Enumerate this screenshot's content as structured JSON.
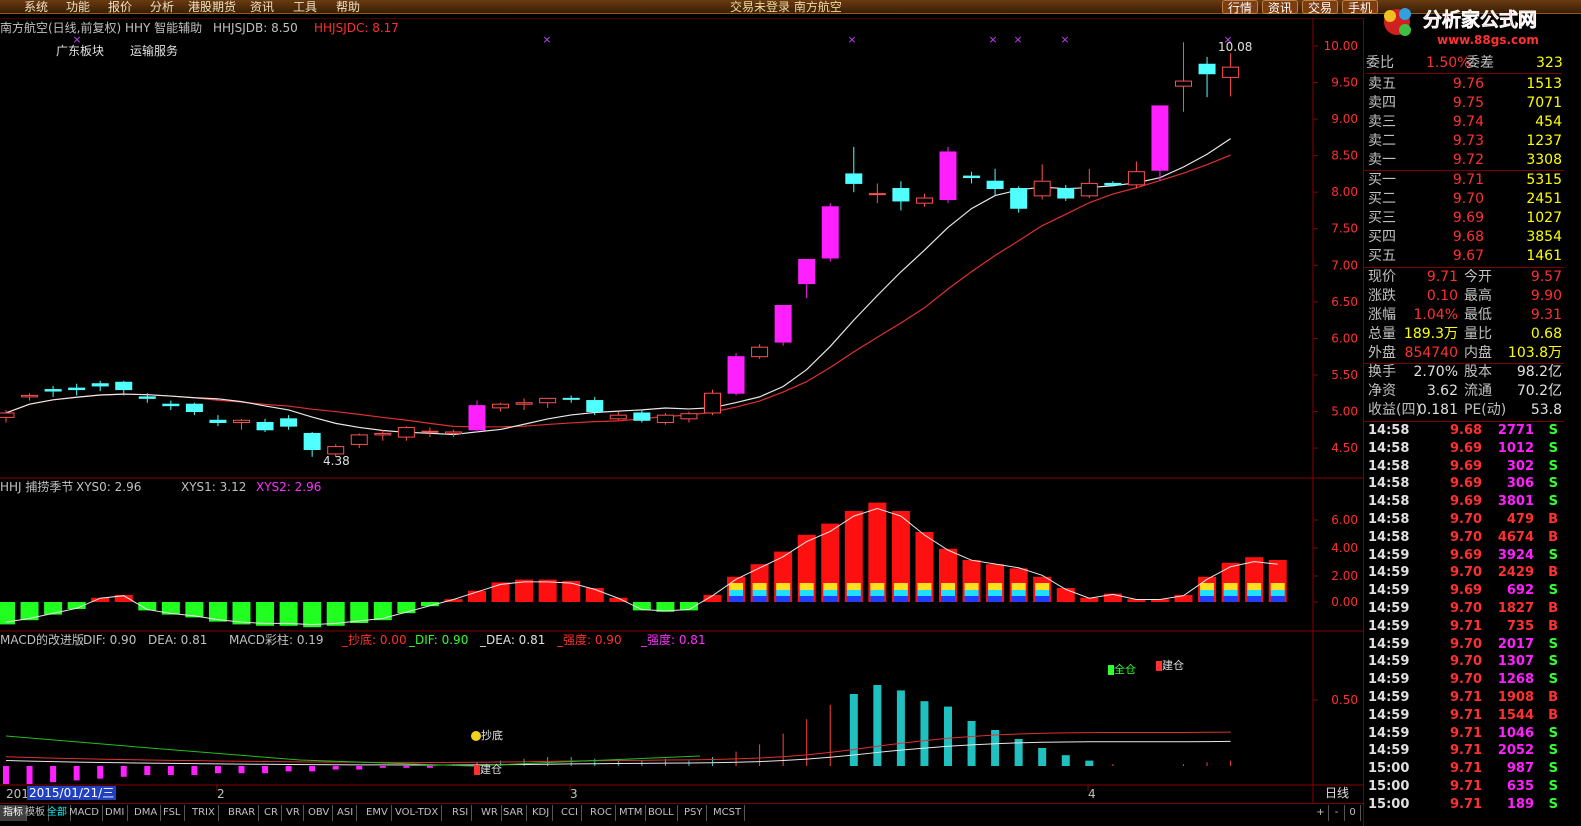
{
  "menu": [
    "系统",
    "功能",
    "报价",
    "分析",
    "港股期货",
    "资讯",
    "工具",
    "帮助"
  ],
  "window_title": "交易未登录   南方航空",
  "top_buttons": [
    "行情",
    "资讯",
    "交易",
    "手机"
  ],
  "logo": {
    "text": "分析家公式网",
    "url": "www.88gs.com"
  },
  "main_chart": {
    "title": "南方航空(日线,前复权) HHY 智能辅助",
    "hhjsjdb": "HHJSJDB: 8.50",
    "hhjsjdc": "HHJSJDC: 8.17",
    "tags": [
      "广东板块",
      "运输服务"
    ],
    "high_label": "10.08",
    "low_label": "4.38",
    "y_ticks": [
      "10.00",
      "9.50",
      "9.00",
      "8.50",
      "8.00",
      "7.50",
      "7.00",
      "6.50",
      "6.00",
      "5.50",
      "5.00",
      "4.50"
    ]
  },
  "xys_panel": {
    "title": "HHJ 捕捞季节",
    "xys0": "XYS0: 2.96",
    "xys1": "XYS1: 3.12",
    "xys2": "XYS2: 2.96",
    "y_ticks": [
      "6.00",
      "4.00",
      "2.00",
      "0.00"
    ]
  },
  "macd_panel": {
    "title": "MACD的改进版",
    "dif": "DIF: 0.90",
    "dea": "DEA: 0.81",
    "macd": "MACD彩柱: 0.19",
    "chaodi": "_抄底: 0.00",
    "dif2": "_DIF: 0.90",
    "dea2": "_DEA: 0.81",
    "qiangdu": "_强度: 0.90",
    "qiangdu2": "_强度: 0.81",
    "y_ticks": [
      "0.50"
    ],
    "marks": {
      "chaodi": "抄底",
      "jiancang": "建仓",
      "quancang": "全仓",
      "jiancang2": "建仓"
    }
  },
  "x_axis": {
    "start": "201",
    "date": "2015/01/21/三",
    "marks": [
      "2",
      "3",
      "4"
    ],
    "period": "日线"
  },
  "tabs": [
    "指标",
    "模板",
    "全部",
    "MACD",
    "DMI",
    "DMA",
    "FSL",
    "TRIX",
    "BRAR",
    "CR",
    "VR",
    "OBV",
    "ASI",
    "EMV",
    "VOL-TDX",
    "RSI",
    "WR",
    "SAR",
    "KDJ",
    "CCI",
    "ROC",
    "MTM",
    "BOLL",
    "PSY",
    "MCST"
  ],
  "scroll_btns": [
    "+",
    "-",
    "0"
  ],
  "side": {
    "header_partial": [
      "委比",
      "1.50%",
      "委差",
      "323"
    ],
    "sells": [
      {
        "name": "卖五",
        "price": "9.76",
        "vol": "1513"
      },
      {
        "name": "卖四",
        "price": "9.75",
        "vol": "7071"
      },
      {
        "name": "卖三",
        "price": "9.74",
        "vol": "454"
      },
      {
        "name": "卖二",
        "price": "9.73",
        "vol": "1237"
      },
      {
        "name": "卖一",
        "price": "9.72",
        "vol": "3308"
      }
    ],
    "buys": [
      {
        "name": "买一",
        "price": "9.71",
        "vol": "5315"
      },
      {
        "name": "买二",
        "price": "9.70",
        "vol": "2451"
      },
      {
        "name": "买三",
        "price": "9.69",
        "vol": "1027"
      },
      {
        "name": "买四",
        "price": "9.68",
        "vol": "3854"
      },
      {
        "name": "买五",
        "price": "9.67",
        "vol": "1461"
      }
    ],
    "quote": [
      [
        "现价",
        "9.71",
        "今开",
        "9.57"
      ],
      [
        "涨跌",
        "0.10",
        "最高",
        "9.90"
      ],
      [
        "涨幅",
        "1.04%",
        "最低",
        "9.31"
      ],
      [
        "总量",
        "189.3万",
        "量比",
        "0.68"
      ],
      [
        "外盘",
        "854740",
        "内盘",
        "103.8万"
      ],
      [
        "换手",
        "2.70%",
        "股本",
        "98.2亿"
      ],
      [
        "净资",
        "3.62",
        "流通",
        "70.2亿"
      ],
      [
        "收益(四)",
        "0.181",
        "PE(动)",
        "53.8"
      ]
    ],
    "ticks": [
      [
        "14:58",
        "9.68",
        "2771",
        "S"
      ],
      [
        "14:58",
        "9.69",
        "1012",
        "S"
      ],
      [
        "14:58",
        "9.69",
        "302",
        "S"
      ],
      [
        "14:58",
        "9.69",
        "306",
        "S"
      ],
      [
        "14:58",
        "9.69",
        "3801",
        "S"
      ],
      [
        "14:58",
        "9.70",
        "479",
        "B"
      ],
      [
        "14:58",
        "9.70",
        "4674",
        "B"
      ],
      [
        "14:59",
        "9.69",
        "3924",
        "S"
      ],
      [
        "14:59",
        "9.70",
        "2429",
        "B"
      ],
      [
        "14:59",
        "9.69",
        "692",
        "S"
      ],
      [
        "14:59",
        "9.70",
        "1827",
        "B"
      ],
      [
        "14:59",
        "9.71",
        "735",
        "B"
      ],
      [
        "14:59",
        "9.70",
        "2017",
        "S"
      ],
      [
        "14:59",
        "9.70",
        "1307",
        "S"
      ],
      [
        "14:59",
        "9.70",
        "1268",
        "S"
      ],
      [
        "14:59",
        "9.71",
        "1908",
        "B"
      ],
      [
        "14:59",
        "9.71",
        "1544",
        "B"
      ],
      [
        "14:59",
        "9.71",
        "1046",
        "S"
      ],
      [
        "14:59",
        "9.71",
        "2052",
        "S"
      ],
      [
        "15:00",
        "9.71",
        "987",
        "S"
      ],
      [
        "15:00",
        "9.71",
        "635",
        "S"
      ],
      [
        "15:00",
        "9.71",
        "189",
        "S"
      ]
    ]
  },
  "chart_data": {
    "type": "candlestick",
    "price_range": [
      4.2,
      10.15
    ],
    "candles": [
      [
        4.92,
        5.02,
        4.85,
        4.98
      ],
      [
        5.2,
        5.25,
        5.15,
        5.22
      ],
      [
        5.3,
        5.35,
        5.2,
        5.28
      ],
      [
        5.32,
        5.38,
        5.22,
        5.3
      ],
      [
        5.38,
        5.42,
        5.28,
        5.35
      ],
      [
        5.4,
        5.42,
        5.22,
        5.3
      ],
      [
        5.2,
        5.25,
        5.12,
        5.18
      ],
      [
        5.1,
        5.15,
        5.02,
        5.08
      ],
      [
        5.1,
        5.12,
        4.95,
        5.0
      ],
      [
        4.88,
        4.95,
        4.8,
        4.85
      ],
      [
        4.85,
        4.9,
        4.75,
        4.88
      ],
      [
        4.85,
        4.9,
        4.72,
        4.75
      ],
      [
        4.9,
        4.95,
        4.75,
        4.8
      ],
      [
        4.7,
        4.72,
        4.38,
        4.48
      ],
      [
        4.42,
        4.55,
        4.38,
        4.52
      ],
      [
        4.55,
        4.7,
        4.5,
        4.68
      ],
      [
        4.68,
        4.75,
        4.6,
        4.7
      ],
      [
        4.65,
        4.8,
        4.6,
        4.78
      ],
      [
        4.72,
        4.78,
        4.65,
        4.73
      ],
      [
        4.7,
        4.75,
        4.65,
        4.72
      ],
      [
        4.75,
        5.15,
        4.72,
        5.08
      ],
      [
        5.05,
        5.12,
        5.0,
        5.1
      ],
      [
        5.1,
        5.18,
        5.02,
        5.12
      ],
      [
        5.12,
        5.18,
        5.05,
        5.18
      ],
      [
        5.18,
        5.22,
        5.12,
        5.17
      ],
      [
        5.15,
        5.2,
        4.95,
        5.0
      ],
      [
        4.9,
        5.0,
        4.88,
        4.95
      ],
      [
        4.98,
        5.02,
        4.85,
        4.88
      ],
      [
        4.85,
        4.98,
        4.82,
        4.95
      ],
      [
        4.9,
        5.0,
        4.85,
        4.97
      ],
      [
        4.98,
        5.3,
        4.95,
        5.25
      ],
      [
        5.25,
        5.8,
        5.22,
        5.75
      ],
      [
        5.75,
        5.92,
        5.72,
        5.88
      ],
      [
        5.95,
        6.45,
        5.9,
        6.45
      ],
      [
        6.75,
        7.08,
        6.55,
        7.08
      ],
      [
        7.1,
        7.85,
        7.05,
        7.8
      ],
      [
        8.25,
        8.62,
        8.0,
        8.12
      ],
      [
        7.98,
        8.12,
        7.85,
        7.98
      ],
      [
        8.05,
        8.15,
        7.75,
        7.88
      ],
      [
        7.85,
        7.98,
        7.8,
        7.92
      ],
      [
        7.9,
        8.62,
        7.85,
        8.55
      ],
      [
        8.22,
        8.28,
        8.12,
        8.2
      ],
      [
        8.15,
        8.32,
        7.95,
        8.05
      ],
      [
        8.05,
        8.08,
        7.72,
        7.78
      ],
      [
        7.95,
        8.38,
        7.9,
        8.15
      ],
      [
        8.05,
        8.1,
        7.88,
        7.92
      ],
      [
        7.95,
        8.32,
        7.92,
        8.12
      ],
      [
        8.12,
        8.15,
        8.08,
        8.1
      ],
      [
        8.1,
        8.42,
        8.05,
        8.28
      ],
      [
        8.3,
        9.18,
        8.15,
        9.18
      ],
      [
        9.45,
        10.05,
        9.1,
        9.52
      ],
      [
        9.75,
        9.85,
        9.3,
        9.62
      ],
      [
        9.57,
        9.9,
        9.31,
        9.71
      ]
    ]
  }
}
